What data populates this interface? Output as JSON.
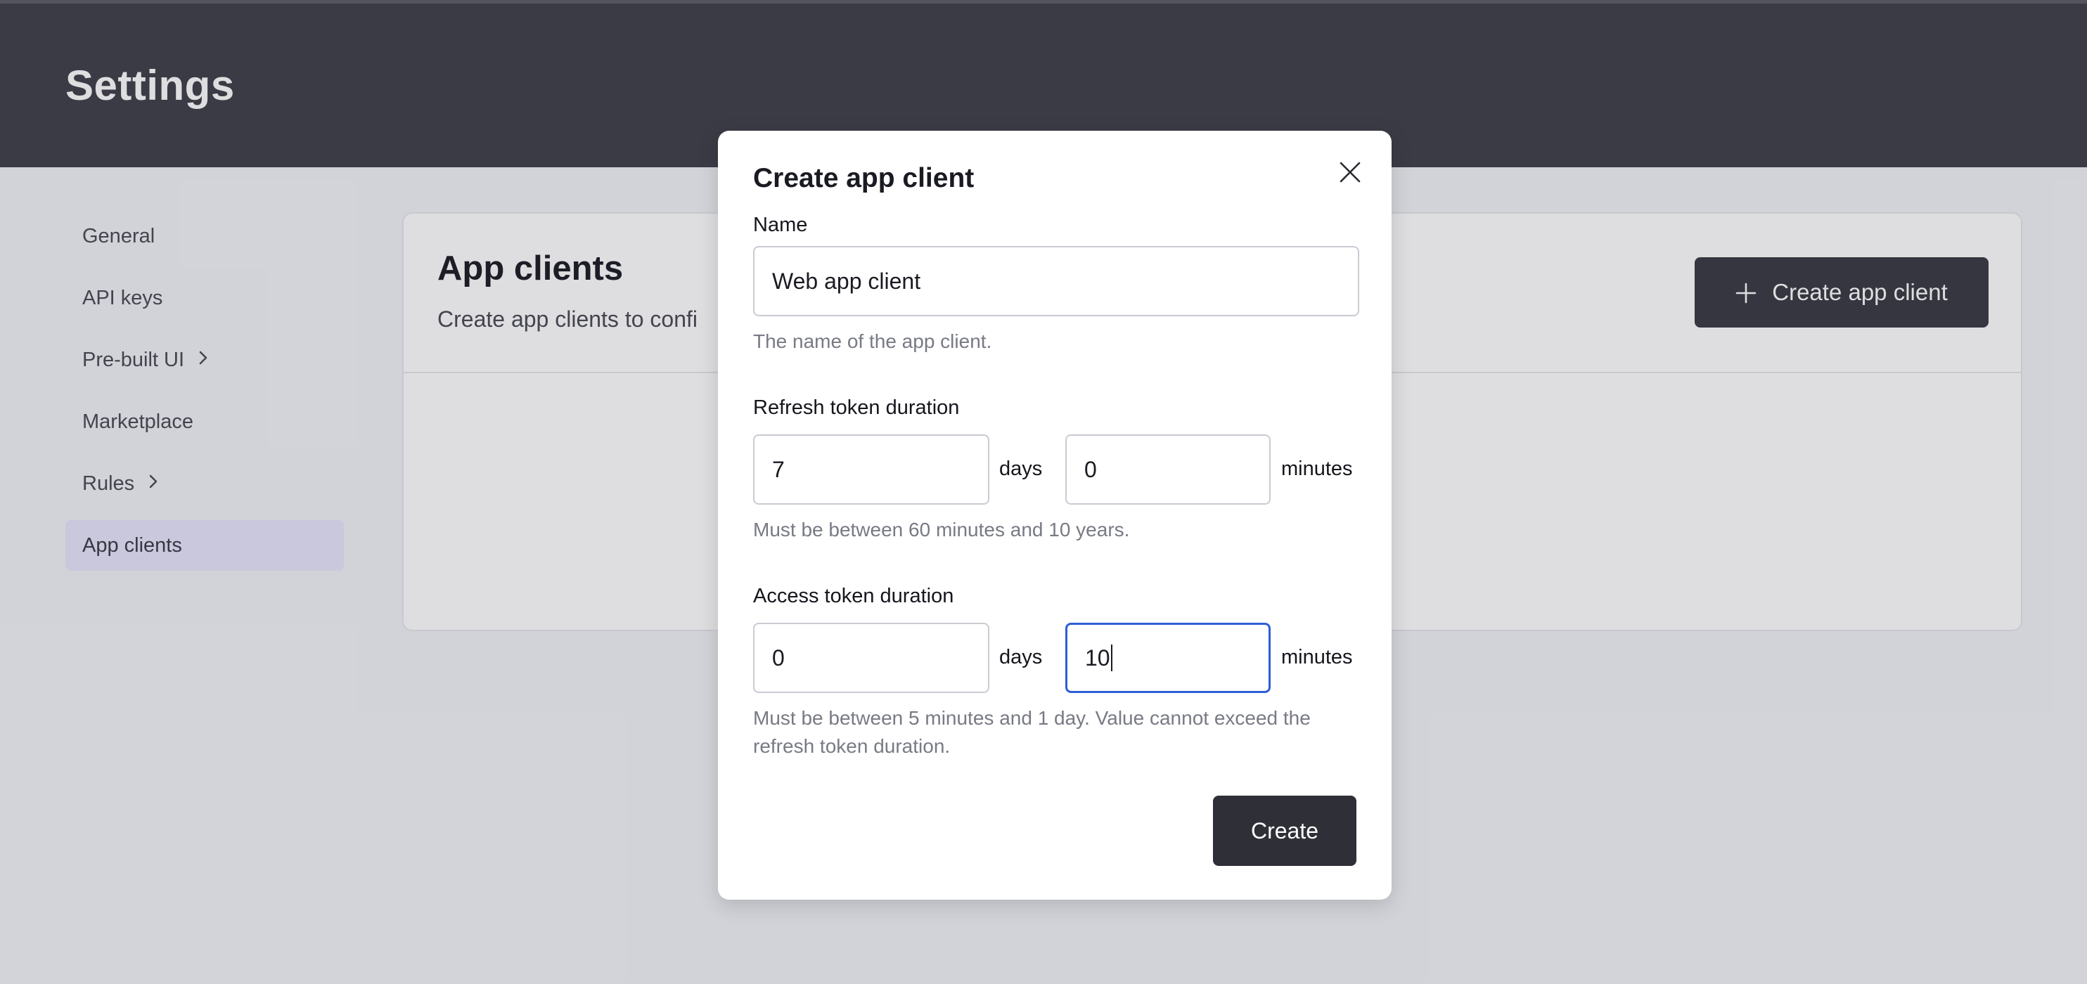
{
  "header": {
    "title": "Settings"
  },
  "sidebar": {
    "items": [
      {
        "label": "General",
        "has_chevron": false,
        "active": false
      },
      {
        "label": "API keys",
        "has_chevron": false,
        "active": false
      },
      {
        "label": "Pre-built UI",
        "has_chevron": true,
        "active": false
      },
      {
        "label": "Marketplace",
        "has_chevron": false,
        "active": false
      },
      {
        "label": "Rules",
        "has_chevron": true,
        "active": false
      },
      {
        "label": "App clients",
        "has_chevron": false,
        "active": true
      }
    ]
  },
  "main": {
    "title": "App clients",
    "subtitle": "Create app clients to confi",
    "create_button_label": "Create app client"
  },
  "modal": {
    "title": "Create app client",
    "name_label": "Name",
    "name_value": "Web app client",
    "name_help": "The name of the app client.",
    "refresh": {
      "label": "Refresh token duration",
      "days_value": "7",
      "days_unit": "days",
      "minutes_value": "0",
      "minutes_unit": "minutes",
      "help": "Must be between 60 minutes and 10 years."
    },
    "access": {
      "label": "Access token duration",
      "days_value": "0",
      "days_unit": "days",
      "minutes_value": "10",
      "minutes_unit": "minutes",
      "help_line1": "Must be between 5 minutes and 1 day. Value cannot exceed the",
      "help_line2": "refresh token duration."
    },
    "create_label": "Create"
  },
  "colors": {
    "header_bg": "#42424c",
    "active_nav_bg": "#e7e6fb",
    "focus_border": "#2e5fd6",
    "primary_button": "#2f3037"
  },
  "icons": {
    "close": "close-icon",
    "plus": "plus-icon",
    "chevron": "chevron-right-icon"
  }
}
